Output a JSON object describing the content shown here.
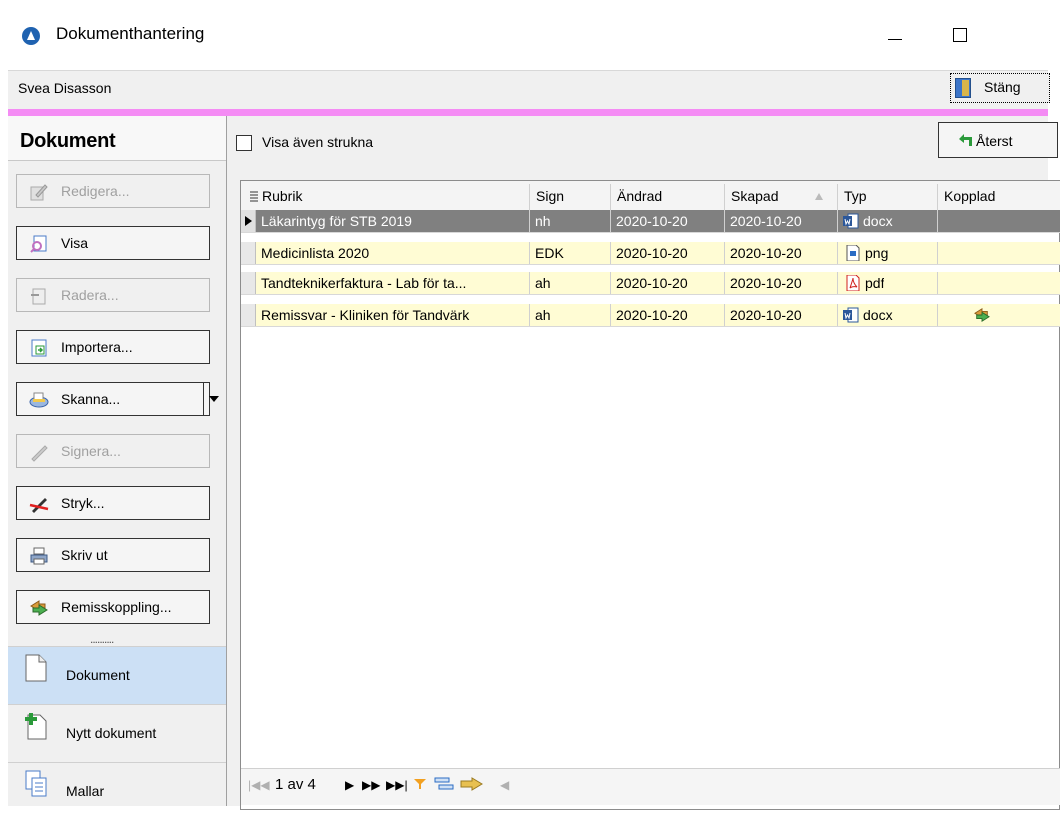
{
  "window": {
    "title": "Dokumenthantering"
  },
  "userbar": {
    "user_name": "Svea Disasson",
    "close_label": "Stäng"
  },
  "left": {
    "title": "Dokument",
    "buttons": [
      {
        "label": "Redigera...",
        "icon": "edit-icon",
        "enabled": false
      },
      {
        "label": "Visa",
        "icon": "view-icon",
        "enabled": true
      },
      {
        "label": "Radera...",
        "icon": "delete-icon",
        "enabled": false
      },
      {
        "label": "Importera...",
        "icon": "import-icon",
        "enabled": true
      },
      {
        "label": "Skanna...",
        "icon": "scanner-icon",
        "enabled": true
      },
      {
        "label": "Signera...",
        "icon": "sign-pen-icon",
        "enabled": false
      },
      {
        "label": "Stryk...",
        "icon": "strike-pen-icon",
        "enabled": true
      },
      {
        "label": "Skriv ut",
        "icon": "printer-icon",
        "enabled": true
      },
      {
        "label": "Remisskoppling...",
        "icon": "referral-link-icon",
        "enabled": true
      }
    ],
    "grip": "..........",
    "nav": [
      {
        "label": "Dokument",
        "icon": "document-icon",
        "active": true
      },
      {
        "label": "Nytt dokument",
        "icon": "new-document-icon",
        "active": false
      },
      {
        "label": "Mallar",
        "icon": "templates-icon",
        "active": false
      }
    ]
  },
  "toolbar": {
    "show_struck_label": "Visa även strukna",
    "restore_label": "Återst"
  },
  "grid": {
    "columns": [
      "Rubrik",
      "Sign",
      "Ändrad",
      "Skapad",
      "Typ",
      "Kopplad"
    ],
    "rows": [
      {
        "rubrik": "Läkarintyg för STB 2019",
        "sign": "nh",
        "andrad": "2020-10-20",
        "skapad": "2020-10-20",
        "typ": "docx",
        "kopplad": false,
        "selected": true
      },
      {
        "rubrik": "Medicinlista 2020",
        "sign": "EDK",
        "andrad": "2020-10-20",
        "skapad": "2020-10-20",
        "typ": "png",
        "kopplad": false,
        "selected": false
      },
      {
        "rubrik": "Tandteknikerfaktura - Lab för ta...",
        "sign": "ah",
        "andrad": "2020-10-20",
        "skapad": "2020-10-20",
        "typ": "pdf",
        "kopplad": false,
        "selected": false
      },
      {
        "rubrik": "Remissvar - Kliniken för Tandvärk",
        "sign": "ah",
        "andrad": "2020-10-20",
        "skapad": "2020-10-20",
        "typ": "docx",
        "kopplad": true,
        "selected": false
      }
    ]
  },
  "pager": {
    "label": "1 av 4"
  },
  "colors": {
    "accent_bar": "#f48cf4",
    "selected_row": "#808080",
    "row_bg": "#fffcd4",
    "active_nav": "#cce0f5"
  }
}
